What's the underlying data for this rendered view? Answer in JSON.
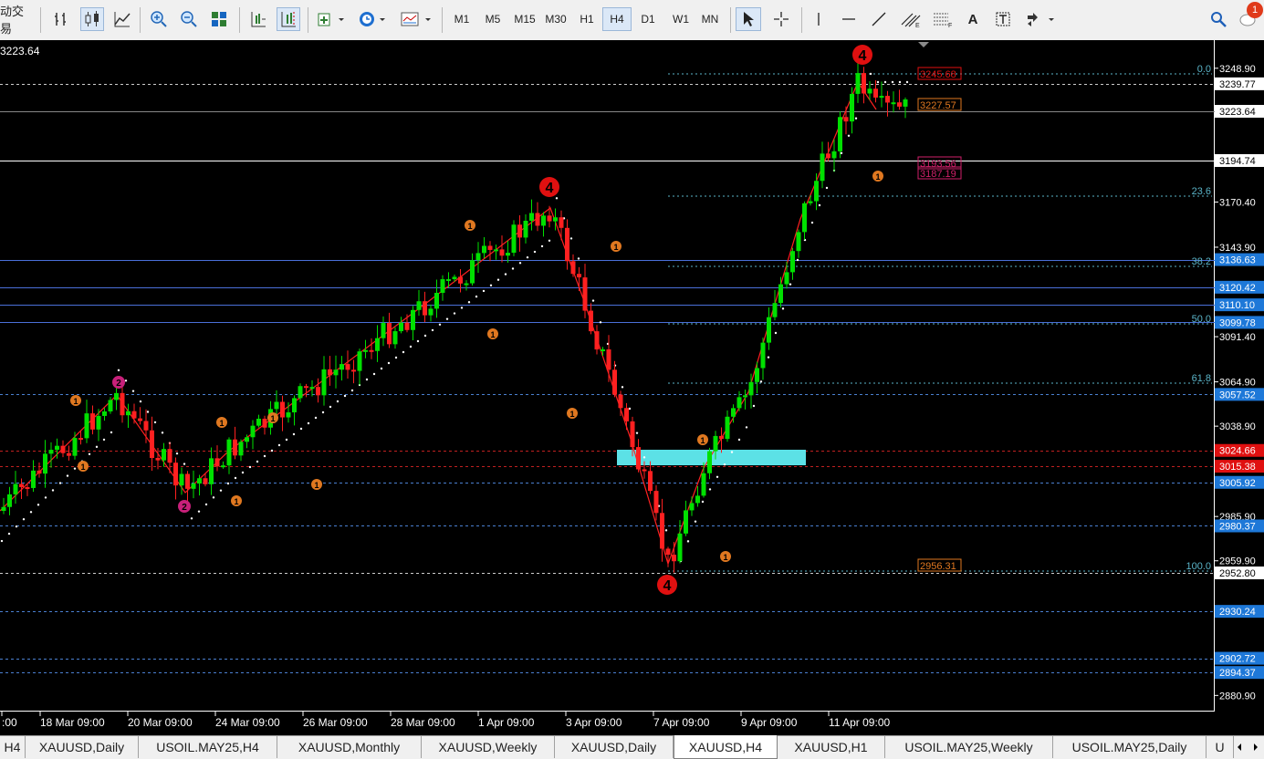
{
  "toolbar": {
    "left_label": "动交易",
    "timeframes": [
      "M1",
      "M5",
      "M15",
      "M30",
      "H1",
      "H4",
      "D1",
      "W1",
      "MN"
    ],
    "active_timeframe": "H4",
    "text_tool": "A",
    "notifications": "1"
  },
  "chart": {
    "corner_price": "3223.64",
    "price_axis": [
      "3248.90",
      "3239.77",
      "3223.64",
      "3194.74",
      "3170.40",
      "3143.90",
      "3136.63",
      "3120.42",
      "3110.10",
      "3099.78",
      "3091.40",
      "3064.90",
      "3057.52",
      "3038.90",
      "3024.66",
      "3015.38",
      "3005.92",
      "2985.90",
      "2980.37",
      "2959.90",
      "2952.80",
      "2930.24",
      "2902.72",
      "2894.37",
      "2880.90"
    ],
    "time_axis": [
      ":00",
      "18 Mar 09:00",
      "20 Mar 09:00",
      "24 Mar 09:00",
      "26 Mar 09:00",
      "28 Mar 09:00",
      "1 Apr 09:00",
      "3 Apr 09:00",
      "7 Apr 09:00",
      "9 Apr 09:00",
      "11 Apr 09:00"
    ],
    "fib_levels": [
      "0.0",
      "23.6",
      "38.2",
      "50.0",
      "61.8",
      "100.0"
    ],
    "target_labels": [
      "3245.68",
      "3227.57",
      "3193.56",
      "3187.19",
      "2956.31"
    ],
    "wave_labels": [
      "4",
      "4",
      "4",
      "2",
      "2",
      "1"
    ]
  },
  "tabs": [
    "H4",
    "XAUUSD,Daily",
    "USOIL.MAY25,H4",
    "XAUUSD,Monthly",
    "XAUUSD,Weekly",
    "XAUUSD,Daily",
    "XAUUSD,H4",
    "XAUUSD,H1",
    "USOIL.MAY25,Weekly",
    "USOIL.MAY25,Daily",
    "U"
  ],
  "active_tab_index": 6,
  "colors": {
    "bull": "#00e000",
    "bear": "#ff2020",
    "bid_line": "#ffffff",
    "support_zone": "#5ce1e6",
    "price_box_blue": "#1e78d8",
    "price_box_red": "#e01010",
    "fib": "#5ab4c8",
    "zigzag": "#ff2020",
    "wave_orange": "#e07820",
    "wave_magenta": "#c8207a"
  }
}
